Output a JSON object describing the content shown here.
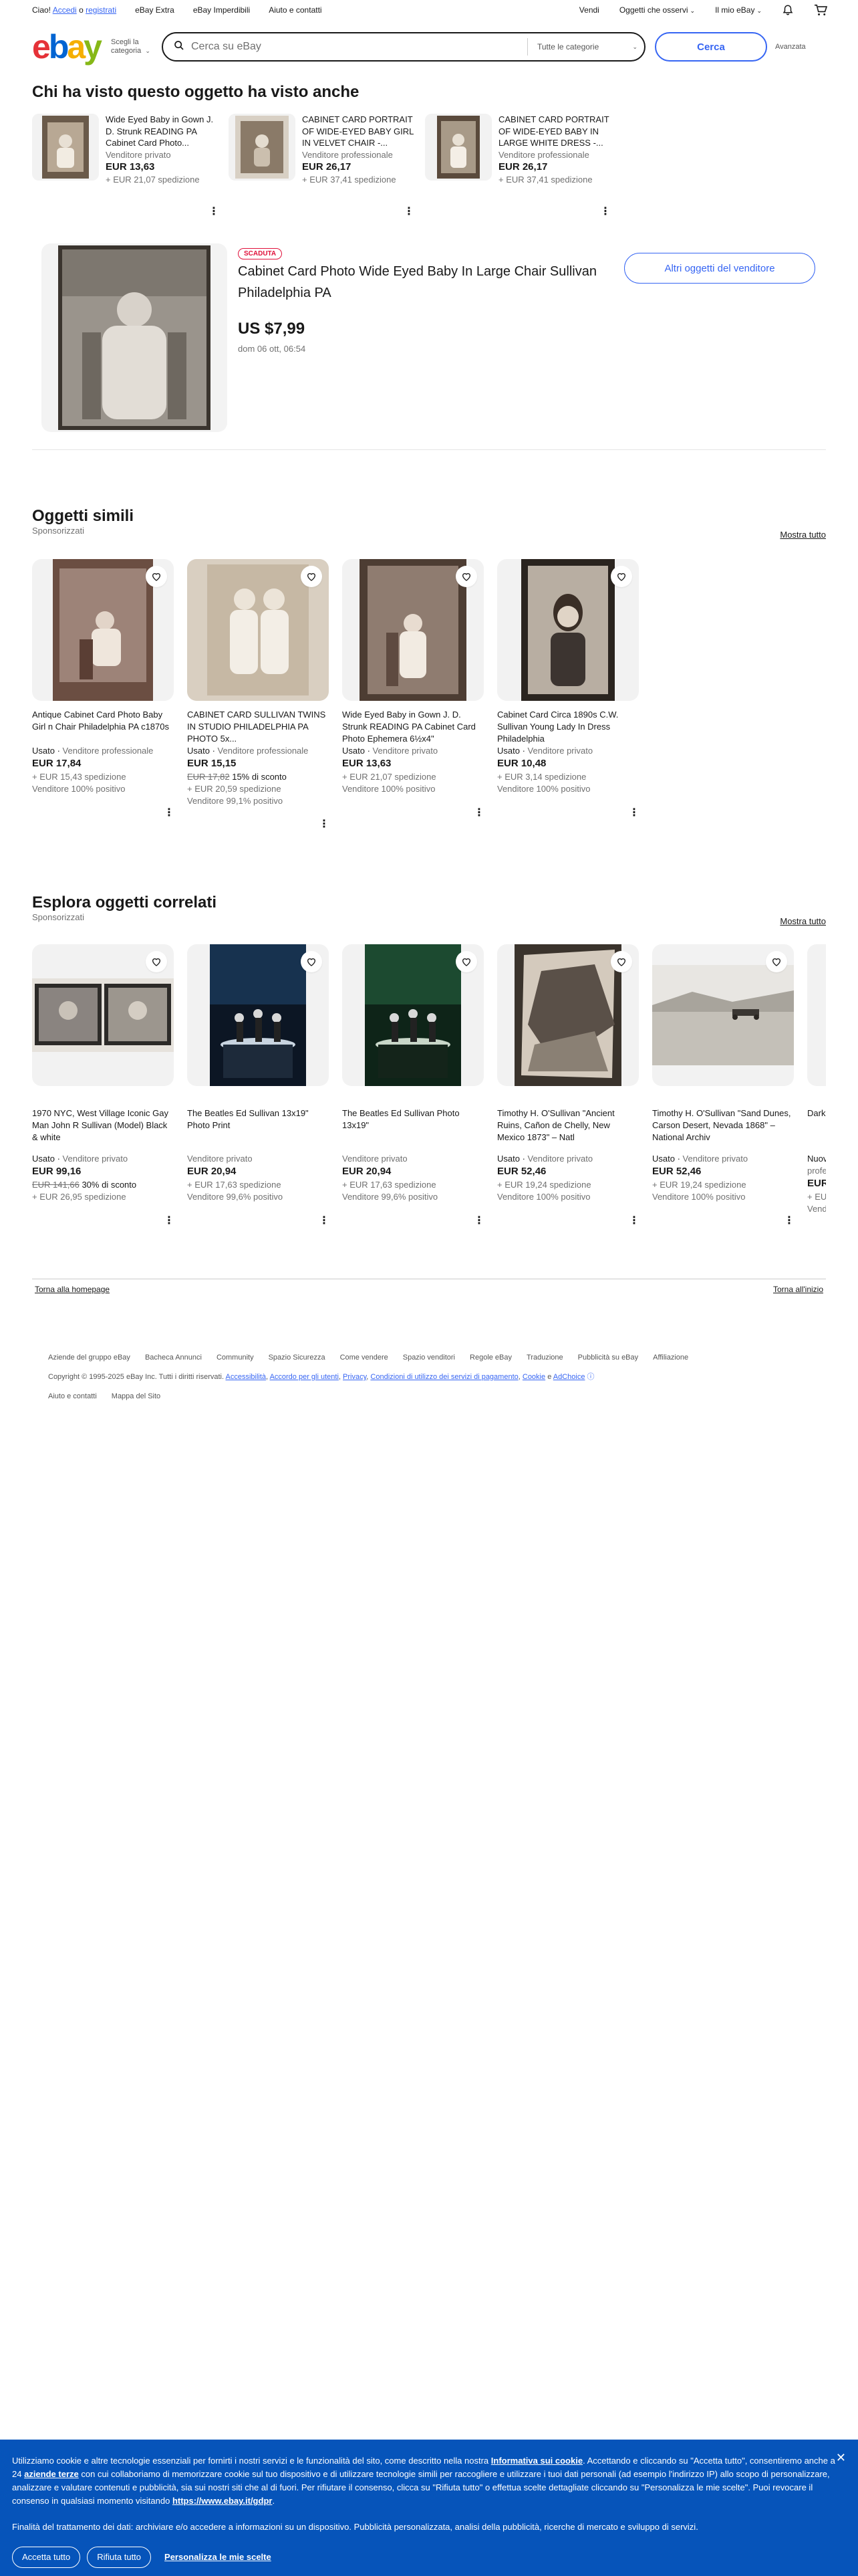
{
  "topbar": {
    "greeting_prefix": "Ciao!",
    "login": "Accedi",
    "or": "o",
    "register": "registrati",
    "links": [
      "eBay Extra",
      "eBay Imperdibili",
      "Aiuto e contatti"
    ],
    "right_links": [
      "Vendi",
      "Oggetti che osservi",
      "Il mio eBay"
    ]
  },
  "header": {
    "logo": [
      "e",
      "b",
      "a",
      "y"
    ],
    "shop_by_category": "Scegli la categoria",
    "search_placeholder": "Cerca su eBay",
    "category_select": "Tutte le categorie",
    "search_button": "Cerca",
    "advanced": "Avanzata"
  },
  "viewed_also": {
    "title": "Chi ha visto questo oggetto ha visto anche",
    "items": [
      {
        "title": "Wide Eyed Baby in Gown J. D. Strunk READING PA Cabinet Card Photo...",
        "seller": "Venditore privato",
        "price": "EUR 13,63",
        "shipping": "+ EUR 21,07 spedizione"
      },
      {
        "title": "CABINET CARD PORTRAIT OF WIDE-EYED BABY GIRL IN VELVET CHAIR -...",
        "seller": "Venditore professionale",
        "price": "EUR 26,17",
        "shipping": "+ EUR 37,41 spedizione"
      },
      {
        "title": "CABINET CARD PORTRAIT OF WIDE-EYED BABY IN LARGE WHITE DRESS -...",
        "seller": "Venditore professionale",
        "price": "EUR 26,17",
        "shipping": "+ EUR 37,41 spedizione"
      }
    ]
  },
  "main_item": {
    "badge": "SCADUTA",
    "title": "Cabinet Card Photo Wide Eyed Baby In Large Chair Sullivan Philadelphia PA",
    "price": "US $7,99",
    "date": "dom 06 ott, 06:54",
    "more_button": "Altri oggetti del venditore"
  },
  "similar": {
    "title": "Oggetti simili",
    "sponsored": "Sponsorizzati",
    "show_all": "Mostra tutto",
    "items": [
      {
        "title": "Antique Cabinet Card Photo Baby Girl n Chair Philadelphia PA c1870s",
        "cond": "Usato",
        "seller": "Venditore professionale",
        "price": "EUR 17,84",
        "orig": "",
        "disc": "",
        "shipping": "+ EUR 15,43 spedizione",
        "feedback": "Venditore 100% positivo"
      },
      {
        "title": "CABINET CARD SULLIVAN TWINS IN STUDIO PHILADELPHIA PA PHOTO 5x...",
        "cond": "Usato",
        "seller": "Venditore professionale",
        "price": "EUR 15,15",
        "orig": "EUR 17,82",
        "disc": "15% di sconto",
        "shipping": "+ EUR 20,59 spedizione",
        "feedback": "Venditore 99,1% positivo"
      },
      {
        "title": "Wide Eyed Baby in Gown J. D. Strunk READING PA Cabinet Card Photo Ephemera 6½x4\"",
        "cond": "Usato",
        "seller": "Venditore privato",
        "price": "EUR 13,63",
        "orig": "",
        "disc": "",
        "shipping": "+ EUR 21,07 spedizione",
        "feedback": "Venditore 100% positivo"
      },
      {
        "title": "Cabinet Card Circa 1890s C.W. Sullivan Young Lady In Dress Philadelphia",
        "cond": "Usato",
        "seller": "Venditore privato",
        "price": "EUR 10,48",
        "orig": "",
        "disc": "",
        "shipping": "+ EUR 3,14 spedizione",
        "feedback": "Venditore 100% positivo"
      }
    ]
  },
  "related": {
    "title": "Esplora oggetti correlati",
    "sponsored": "Sponsorizzati",
    "show_all": "Mostra tutto",
    "items": [
      {
        "title": "1970 NYC, West Village Iconic Gay Man John R Sullivan (Model) Black & white",
        "cond": "Usato",
        "seller": "Venditore privato",
        "price": "EUR 99,16",
        "orig": "EUR 141,66",
        "disc": "30% di sconto",
        "shipping": "+ EUR 26,95 spedizione",
        "feedback": ""
      },
      {
        "title": "The Beatles Ed Sullivan 13x19\" Photo Print",
        "cond": "",
        "seller": "Venditore privato",
        "price": "EUR 20,94",
        "orig": "",
        "disc": "",
        "shipping": "+ EUR 17,63 spedizione",
        "feedback": "Venditore 99,6% positivo"
      },
      {
        "title": "The Beatles Ed Sullivan Photo 13x19\"",
        "cond": "",
        "seller": "Venditore privato",
        "price": "EUR 20,94",
        "orig": "",
        "disc": "",
        "shipping": "+ EUR 17,63 spedizione",
        "feedback": "Venditore 99,6% positivo"
      },
      {
        "title": "Timothy H. O'Sullivan \"Ancient Ruins, Cañon de Chelly, New Mexico 1873\" – Natl",
        "cond": "Usato",
        "seller": "Venditore privato",
        "price": "EUR 52,46",
        "orig": "",
        "disc": "",
        "shipping": "+ EUR 19,24 spedizione",
        "feedback": "Venditore 100% positivo"
      },
      {
        "title": "Timothy H. O'Sullivan \"Sand Dunes, Carson Desert, Nevada 1868\" – National Archiv",
        "cond": "Usato",
        "seller": "Venditore privato",
        "price": "EUR 52,46",
        "orig": "",
        "disc": "",
        "shipping": "+ EUR 19,24 spedizione",
        "feedback": "Venditore 100% positivo"
      },
      {
        "title": "Dark Phot",
        "cond": "Nuov",
        "seller": "profe",
        "price": "EUR",
        "orig": "",
        "disc": "",
        "shipping": "+ EU",
        "feedback": "Vend"
      }
    ]
  },
  "footer": {
    "back_home": "Torna alla homepage",
    "back_top": "Torna all'inizio",
    "links": [
      "Aziende del gruppo eBay",
      "Bacheca Annunci",
      "Community",
      "Spazio Sicurezza",
      "Come vendere",
      "Spazio venditori",
      "Regole eBay",
      "Traduzione",
      "Pubblicità su eBay",
      "Affiliazione"
    ],
    "links3": [
      "Aiuto e contatti",
      "Mappa del Sito"
    ],
    "copyright": "Copyright © 1995-2025 eBay Inc. Tutti i diritti riservati.",
    "legal": [
      "Accessibilità",
      "Accordo per gli utenti",
      "Privacy",
      "Condizioni di utilizzo dei servizi di pagamento",
      "Cookie",
      "AdChoice"
    ],
    "and": "e"
  },
  "cookie": {
    "text1": "Utilizziamo cookie e altre tecnologie essenziali per fornirti i nostri servizi e le funzionalità del sito, come descritto nella nostra",
    "link1": "Informativa sui cookie",
    "text2": ". Accettando e cliccando su \"Accetta tutto\", consentiremo anche a 24",
    "link2": "aziende terze",
    "text3": "con cui collaboriamo di memorizzare cookie sul tuo dispositivo e di utilizzare tecnologie simili per raccogliere e utilizzare i tuoi dati personali (ad esempio l'indirizzo IP) allo scopo di personalizzare, analizzare e valutare contenuti e pubblicità, sia sui nostri siti che al di fuori. Per rifiutare il consenso, clicca su \"Rifiuta tutto\" o effettua scelte dettagliate cliccando su \"Personalizza le mie scelte\". Puoi revocare il consenso in qualsiasi momento visitando",
    "link3": "https://www.ebay.it/gdpr",
    "purpose": "Finalità del trattamento dei dati: archiviare e/o accedere a informazioni su un dispositivo. Pubblicità personalizzata, analisi della pubblicità, ricerche di mercato e sviluppo di servizi.",
    "accept": "Accetta tutto",
    "reject": "Rifiuta tutto",
    "customize": "Personalizza le mie scelte"
  }
}
